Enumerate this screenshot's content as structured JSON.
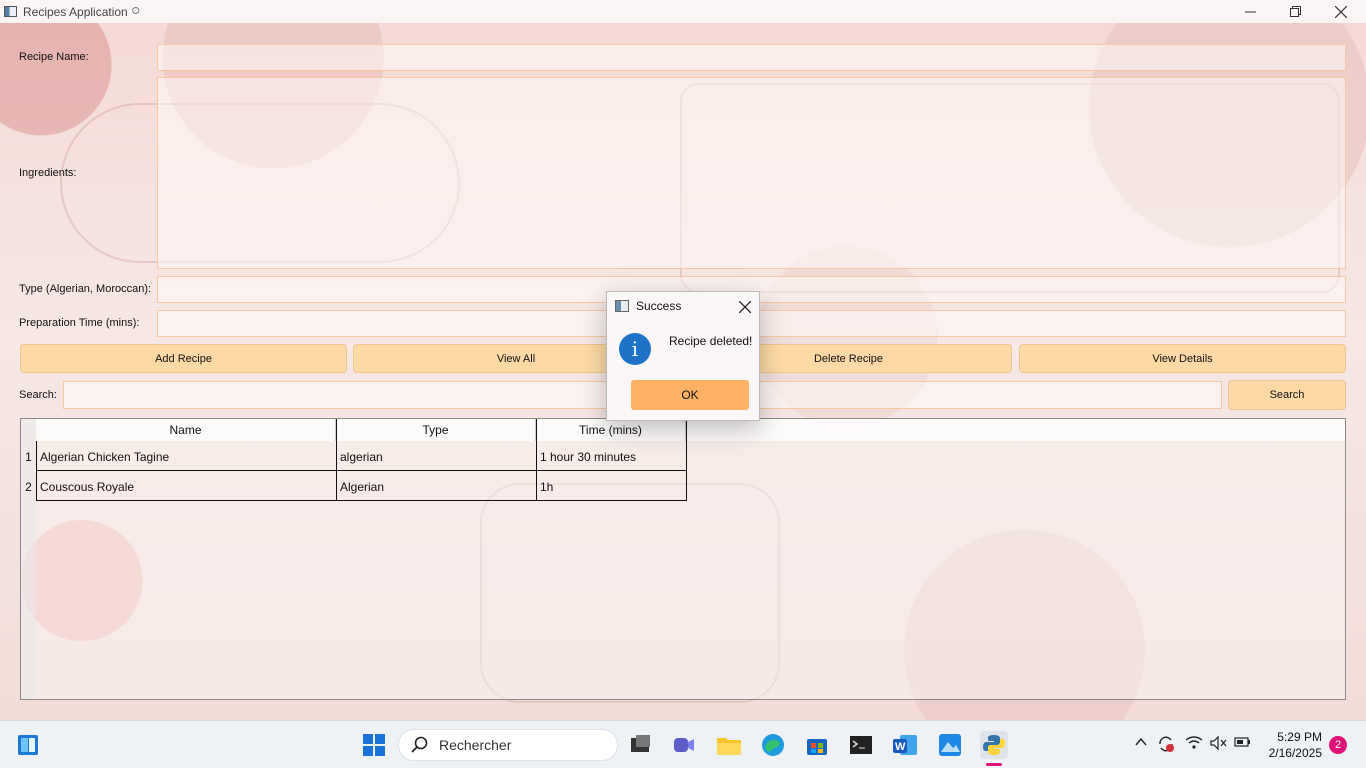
{
  "window": {
    "title": "Recipes Application",
    "title_extra": "⭘"
  },
  "form": {
    "recipe_name_label": "Recipe Name:",
    "ingredients_label": "Ingredients:",
    "type_label": "Type (Algerian, Moroccan):",
    "time_label": "Preparation Time (mins):",
    "recipe_name_value": "",
    "ingredients_value": "",
    "type_value": "",
    "time_value": ""
  },
  "buttons": {
    "add": "Add Recipe",
    "view_all": "View All",
    "delete": "Delete Recipe",
    "details": "View Details"
  },
  "search": {
    "label": "Search:",
    "value": "",
    "button": "Search"
  },
  "table": {
    "headers": [
      "Name",
      "Type",
      "Time (mins)"
    ],
    "rows": [
      {
        "num": "1",
        "name": "Algerian Chicken Tagine",
        "type": "algerian",
        "time": "1 hour 30 minutes"
      },
      {
        "num": "2",
        "name": "Couscous Royale",
        "type": "Algerian",
        "time": "1h"
      }
    ]
  },
  "dialog": {
    "title": "Success",
    "message": "Recipe deleted!",
    "ok": "OK"
  },
  "taskbar": {
    "search_placeholder": "Rechercher",
    "time": "5:29 PM",
    "date": "2/16/2025",
    "notification_count": "2"
  },
  "colors": {
    "accent": "#fdb164",
    "button": "#fdd9a6",
    "field_border": "#f6c7a0",
    "info_blue": "#1e73c8"
  }
}
